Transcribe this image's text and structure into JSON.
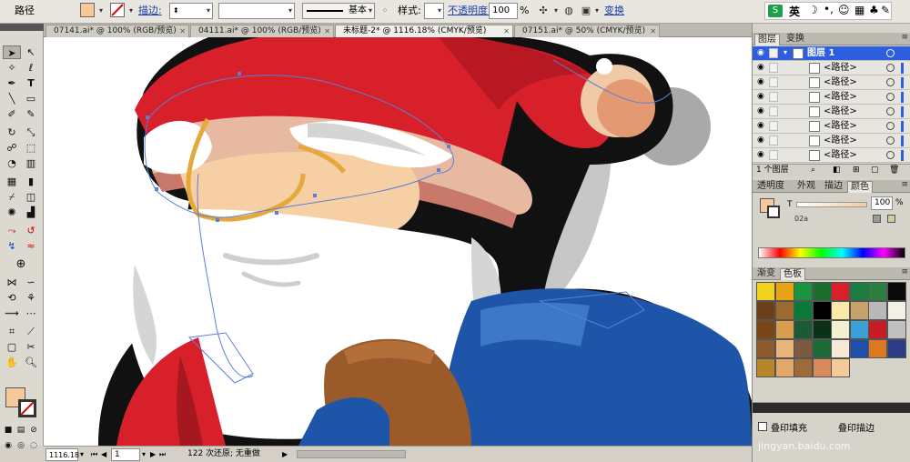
{
  "control_bar": {
    "object_type": "路径",
    "stroke_label": "描边:",
    "stroke_profile": "基本",
    "style_label": "样式:",
    "opacity_label": "不透明度:",
    "opacity_value": "100",
    "opacity_unit": "%",
    "transform_link": "变换",
    "fill_color": "#f6c99a",
    "ime_label": "英"
  },
  "tabs": [
    {
      "label": "07141.ai* @ 100% (RGB/预览)"
    },
    {
      "label": "04111.ai* @ 100% (RGB/预览)"
    },
    {
      "label": "未标题-2* @ 1116.18% (CMYK/预览)"
    },
    {
      "label": "07151.ai* @ 50% (CMYK/预览)"
    }
  ],
  "status": {
    "zoom": "1116.18",
    "page": "1",
    "message": "122 次还原; 无重做"
  },
  "layers_panel": {
    "tabs": [
      "图层",
      "变换"
    ],
    "layer_name": "图层 1",
    "paths": [
      "<路径>",
      "<路径>",
      "<路径>",
      "<路径>",
      "<路径>",
      "<路径>",
      "<路径>"
    ],
    "count_label": "1 个图层"
  },
  "color_panel": {
    "tabs": [
      "透明度",
      "外观",
      "描边",
      "颜色"
    ],
    "channel": "T",
    "value": "100",
    "unit": "%",
    "hex_hint": "02a"
  },
  "swatches_panel": {
    "tabs": [
      "渐变",
      "色板"
    ],
    "colors": [
      "#f2d21f",
      "#e8a317",
      "#1a9440",
      "#1d6d2e",
      "#d9202a",
      "#1b7d40",
      "#2d7f3f",
      "#0a0a0a",
      "#6b3f1a",
      "#9c6b2f",
      "#0a7a3a",
      "#000000",
      "#fce9a8",
      "#c7a36a",
      "#b8b8b8",
      "#f4f0e6",
      "#7a4616",
      "#d99d4e",
      "#1c5a35",
      "#0d3018",
      "#f3f0cf",
      "#3aa0d6",
      "#c91b25",
      "#c0c0c0",
      "#8e5a2c",
      "#e7b57a",
      "#7b5a3f",
      "#1c6b37",
      "#f6e9d5",
      "#1f4fa8",
      "#dc7a24",
      "#2c3c86",
      "#b8862a",
      "#e3a76a",
      "#9d6a3a",
      "#d98a5a",
      "#f6c99a"
    ]
  },
  "bottom_panel": {
    "checkbox_label": "叠印填充",
    "overprint_label": "叠印描边"
  },
  "watermark": {
    "text": "jingyan.baidu.com"
  }
}
